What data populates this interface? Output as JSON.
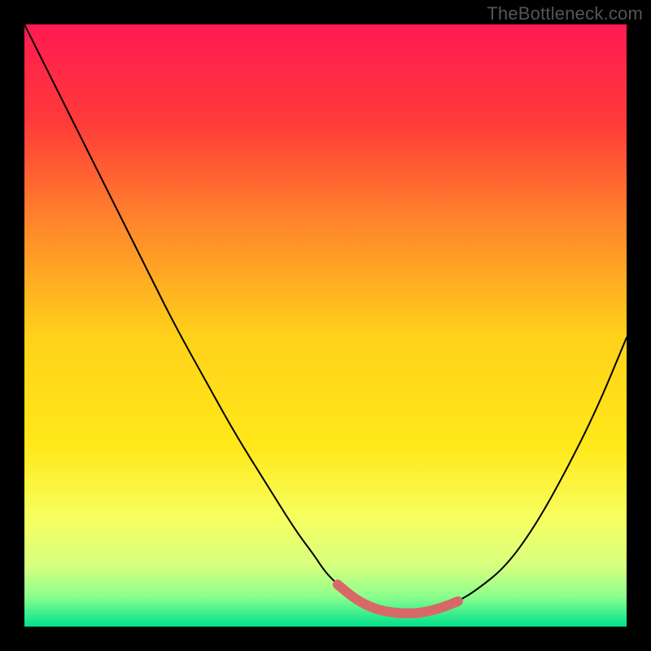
{
  "watermark": "TheBottleneck.com",
  "chart_data": {
    "type": "line",
    "title": "",
    "xlabel": "",
    "ylabel": "",
    "xlim": [
      0,
      100
    ],
    "ylim": [
      0,
      100
    ],
    "grid": false,
    "legend": false,
    "background_gradient_stops": [
      {
        "offset": 0.0,
        "color": "#ff1a52"
      },
      {
        "offset": 0.16,
        "color": "#ff3a3a"
      },
      {
        "offset": 0.34,
        "color": "#ff8a2a"
      },
      {
        "offset": 0.52,
        "color": "#ffd21a"
      },
      {
        "offset": 0.7,
        "color": "#ffe81a"
      },
      {
        "offset": 0.82,
        "color": "#f7ff60"
      },
      {
        "offset": 0.9,
        "color": "#d6ff80"
      },
      {
        "offset": 0.95,
        "color": "#8cff8c"
      },
      {
        "offset": 1.0,
        "color": "#00e08c"
      }
    ],
    "series": [
      {
        "name": "bottleneck-curve",
        "stroke": "#000000",
        "x": [
          0,
          5,
          10,
          15,
          20,
          25,
          30,
          35,
          40,
          45,
          48,
          50,
          52,
          55,
          58,
          61,
          64,
          66,
          69,
          72,
          75,
          80,
          85,
          90,
          95,
          100
        ],
        "y": [
          100,
          90,
          80,
          70,
          60,
          50,
          41,
          32,
          24,
          16,
          12,
          9,
          7,
          4.5,
          3,
          2.3,
          2.2,
          2.3,
          3,
          4.2,
          6,
          10,
          17,
          26,
          36,
          48
        ]
      },
      {
        "name": "highlight-band",
        "stroke": "#d86868",
        "stroke_width": 12,
        "x": [
          52,
          55,
          58,
          61,
          64,
          66,
          69,
          72
        ],
        "y": [
          7,
          4.5,
          3,
          2.3,
          2.2,
          2.3,
          3,
          4.2
        ]
      }
    ]
  }
}
